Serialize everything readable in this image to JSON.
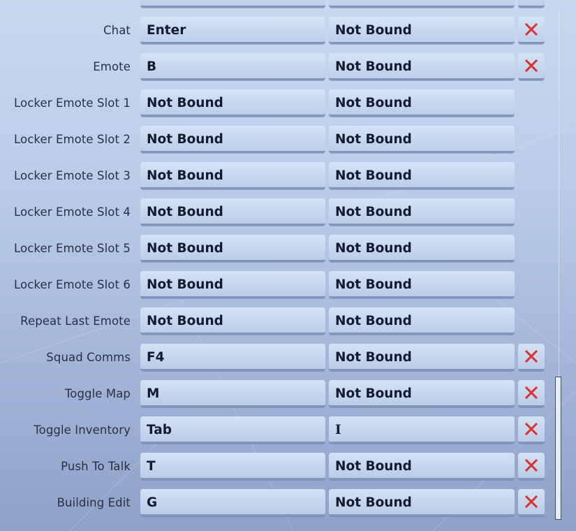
{
  "colors": {
    "clear_icon": "#d8332f"
  },
  "bindings": [
    {
      "action": "",
      "primary": "",
      "secondary": "",
      "clearable": true
    },
    {
      "action": "Chat",
      "primary": "Enter",
      "secondary": "Not Bound",
      "clearable": true
    },
    {
      "action": "Emote",
      "primary": "B",
      "secondary": "Not Bound",
      "clearable": true
    },
    {
      "action": "Locker Emote Slot 1",
      "primary": "Not Bound",
      "secondary": "Not Bound",
      "clearable": false
    },
    {
      "action": "Locker Emote Slot 2",
      "primary": "Not Bound",
      "secondary": "Not Bound",
      "clearable": false
    },
    {
      "action": "Locker Emote Slot 3",
      "primary": "Not Bound",
      "secondary": "Not Bound",
      "clearable": false
    },
    {
      "action": "Locker Emote Slot 4",
      "primary": "Not Bound",
      "secondary": "Not Bound",
      "clearable": false
    },
    {
      "action": "Locker Emote Slot 5",
      "primary": "Not Bound",
      "secondary": "Not Bound",
      "clearable": false
    },
    {
      "action": "Locker Emote Slot 6",
      "primary": "Not Bound",
      "secondary": "Not Bound",
      "clearable": false
    },
    {
      "action": "Repeat Last Emote",
      "primary": "Not Bound",
      "secondary": "Not Bound",
      "clearable": false
    },
    {
      "action": "Squad Comms",
      "primary": "F4",
      "secondary": "Not Bound",
      "clearable": true
    },
    {
      "action": "Toggle Map",
      "primary": "M",
      "secondary": "Not Bound",
      "clearable": true
    },
    {
      "action": "Toggle Inventory",
      "primary": "Tab",
      "secondary": "I",
      "clearable": true
    },
    {
      "action": "Push To Talk",
      "primary": "T",
      "secondary": "Not Bound",
      "clearable": true
    },
    {
      "action": "Building Edit",
      "primary": "G",
      "secondary": "Not Bound",
      "clearable": true
    }
  ],
  "scroll": {
    "position_fraction": 0.72
  }
}
